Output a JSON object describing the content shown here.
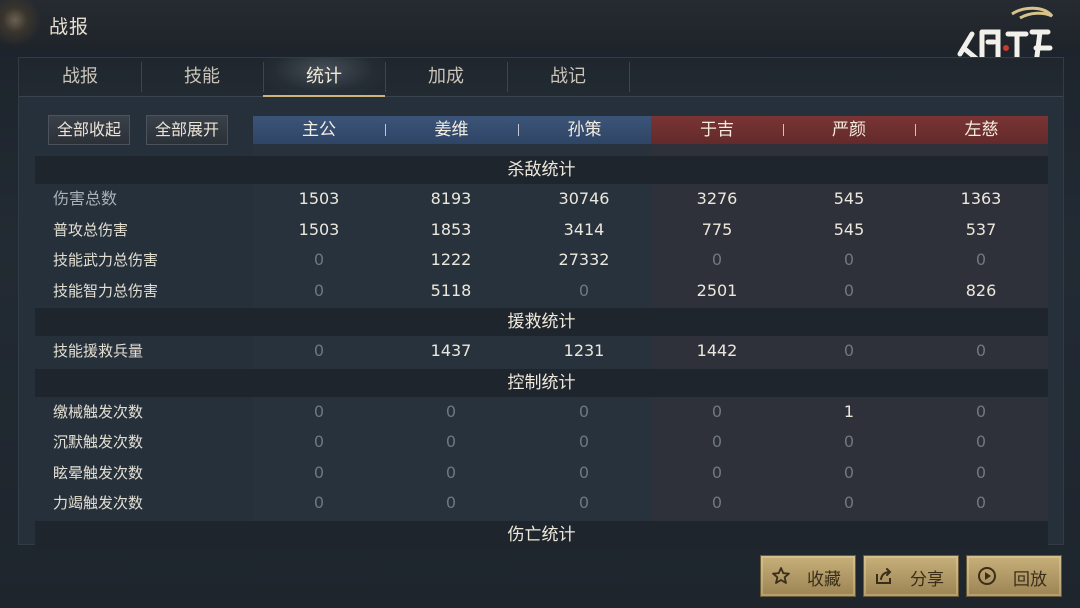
{
  "header": {
    "title": "战报"
  },
  "tabs": [
    {
      "label": "战报"
    },
    {
      "label": "技能"
    },
    {
      "label": "统计"
    },
    {
      "label": "加成"
    },
    {
      "label": "战记"
    }
  ],
  "active_tab_index": 2,
  "controls": {
    "collapse_all": "全部收起",
    "expand_all": "全部展开"
  },
  "teams": {
    "ally": {
      "color": "#34506f",
      "heroes": [
        "主公",
        "姜维",
        "孙策"
      ]
    },
    "enemy": {
      "color": "#6e2f30",
      "heroes": [
        "于吉",
        "严颜",
        "左慈"
      ]
    }
  },
  "sections": [
    {
      "title": "杀敌统计",
      "rows": [
        {
          "label": "伤害总数",
          "values": [
            "1503",
            "8193",
            "30746",
            "3276",
            "545",
            "1363"
          ]
        },
        {
          "label": "普攻总伤害",
          "values": [
            "1503",
            "1853",
            "3414",
            "775",
            "545",
            "537"
          ]
        },
        {
          "label": "技能武力总伤害",
          "values": [
            "0",
            "1222",
            "27332",
            "0",
            "0",
            "0"
          ]
        },
        {
          "label": "技能智力总伤害",
          "values": [
            "0",
            "5118",
            "0",
            "2501",
            "0",
            "826"
          ]
        }
      ]
    },
    {
      "title": "援救统计",
      "rows": [
        {
          "label": "技能援救兵量",
          "values": [
            "0",
            "1437",
            "1231",
            "1442",
            "0",
            "0"
          ]
        }
      ]
    },
    {
      "title": "控制统计",
      "rows": [
        {
          "label": "缴械触发次数",
          "values": [
            "0",
            "0",
            "0",
            "0",
            "1",
            "0"
          ]
        },
        {
          "label": "沉默触发次数",
          "values": [
            "0",
            "0",
            "0",
            "0",
            "0",
            "0"
          ]
        },
        {
          "label": "眩晕触发次数",
          "values": [
            "0",
            "0",
            "0",
            "0",
            "0",
            "0"
          ]
        },
        {
          "label": "力竭触发次数",
          "values": [
            "0",
            "0",
            "0",
            "0",
            "0",
            "0"
          ]
        }
      ]
    },
    {
      "title": "伤亡统计",
      "rows": []
    }
  ],
  "footer": {
    "favorite": {
      "label": "收藏",
      "icon": "star-icon"
    },
    "share": {
      "label": "分享",
      "icon": "share-icon"
    },
    "replay": {
      "label": "回放",
      "icon": "play-icon"
    }
  },
  "colors": {
    "accent_gold": "#cdb57a",
    "ally_blue": "#34506f",
    "enemy_red": "#6e2f30"
  }
}
